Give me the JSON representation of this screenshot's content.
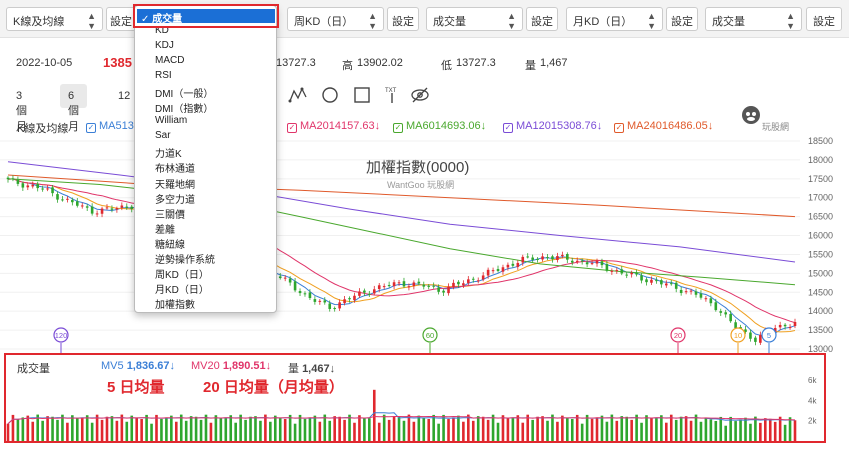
{
  "toolbar": {
    "selects": [
      "K線及均線",
      "成交量",
      "周KD（日）",
      "成交量",
      "月KD（日）",
      "成交量"
    ],
    "settings_label": "設定"
  },
  "info": {
    "date": "2022-10-05",
    "close_partial": "1385",
    "open": "13727.3",
    "high_label": "高",
    "high": "13902.02",
    "low_label": "低",
    "low": "13727.3",
    "volume_label": "量",
    "volume": "1,467"
  },
  "ranges": [
    "3 個月",
    "6 個月",
    "12"
  ],
  "ma_legend": {
    "title": "K線及均線",
    "items": [
      {
        "label": "MA5",
        "value": "13",
        "color": "#3b7fd6"
      },
      {
        "label": "MA20",
        "value": "14157.63",
        "arrow": "↓",
        "color": "#e0356a"
      },
      {
        "label": "MA60",
        "value": "14693.06",
        "arrow": "↓",
        "color": "#4aa82e"
      },
      {
        "label": "MA120",
        "value": "15308.76",
        "arrow": "↓",
        "color": "#7a4cd6"
      },
      {
        "label": "MA240",
        "value": "16486.05",
        "arrow": "↓",
        "color": "#e05a2b"
      }
    ]
  },
  "chart_title": "加權指數(0000)",
  "watermark": "WantGoo 玩股網",
  "logo_text": "玩股網",
  "y_axis": [
    "18500",
    "18000",
    "17500",
    "17000",
    "16500",
    "16000",
    "15500",
    "15000",
    "14500",
    "14000",
    "13500",
    "13000"
  ],
  "badges": [
    {
      "text": "120",
      "color": "#7a4cd6"
    },
    {
      "text": "60",
      "color": "#4aa82e"
    },
    {
      "text": "20",
      "color": "#e0356a"
    },
    {
      "text": "10",
      "color": "#f0a020"
    },
    {
      "text": "5",
      "color": "#3b7fd6"
    }
  ],
  "volume": {
    "title": "成交量",
    "mv5_label": "MV5",
    "mv5": "1,836.67",
    "mv20_label": "MV20",
    "mv20": "1,890.51",
    "vol_label": "量",
    "vol": "1,467",
    "arrow": "↓",
    "y_axis": [
      "6k",
      "4k",
      "2k"
    ]
  },
  "annotations": {
    "mv5": "5 日均量",
    "mv20": "20 日均量（月均量）"
  },
  "dropdown": {
    "selected": "成交量",
    "check": "✓",
    "items": [
      "KD",
      "KDJ",
      "MACD",
      "RSI",
      "DMI（一般）",
      "DMI（指數）",
      "William",
      "Sar",
      "力道K",
      "布林通道",
      "天羅地網",
      "多空力道",
      "三關價",
      "差離",
      "糖紐線",
      "逆勢操作系統",
      "周KD（日）",
      "月KD（日）",
      "加權指數"
    ]
  },
  "colors": {
    "up": "#e0282e",
    "down": "#2ea62e",
    "highlight": "#e0282e",
    "selected": "#1b6fd6"
  }
}
